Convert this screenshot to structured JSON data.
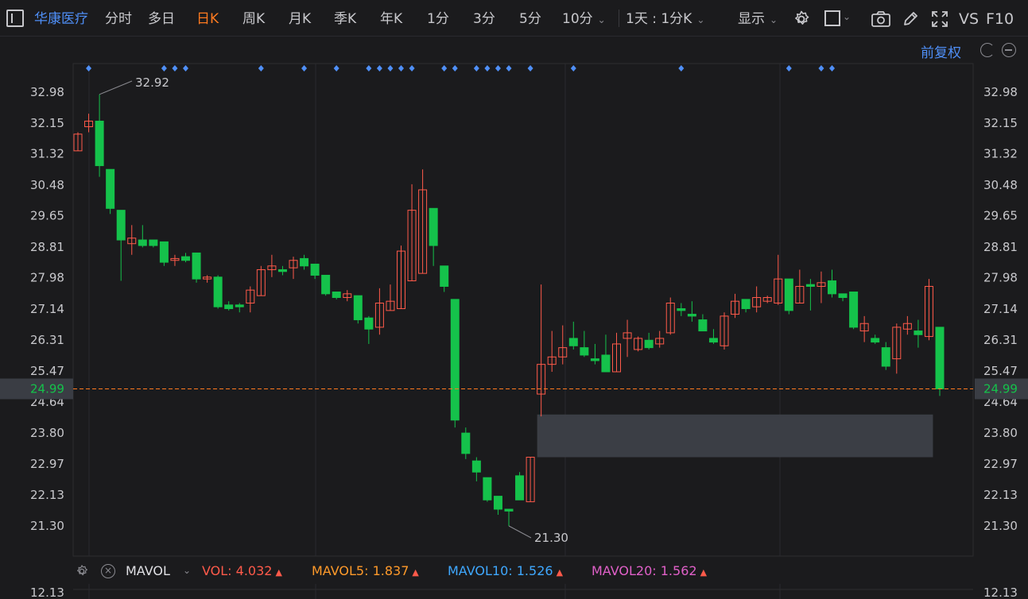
{
  "toolbar": {
    "stock_name": "华康医疗",
    "tabs": [
      {
        "label": "分时",
        "active": false
      },
      {
        "label": "多日",
        "active": false
      },
      {
        "label": "日K",
        "active": true
      },
      {
        "label": "周K",
        "active": false
      },
      {
        "label": "月K",
        "active": false
      },
      {
        "label": "季K",
        "active": false
      },
      {
        "label": "年K",
        "active": false
      },
      {
        "label": "1分",
        "active": false
      },
      {
        "label": "3分",
        "active": false
      },
      {
        "label": "5分",
        "active": false
      },
      {
        "label": "10分",
        "active": false
      }
    ],
    "period_select": "1天 : 1分K",
    "display_label": "显示",
    "vs_label": "VS",
    "f10_label": "F10"
  },
  "chart_header": {
    "adjust_label": "前复权"
  },
  "colors": {
    "up": "#ff5a4a",
    "down": "#15c24b",
    "accent": "#ff7a1f",
    "link": "#4f8ff7",
    "marker": "#4f8ff7",
    "price_line": "#ff7a1f",
    "price_tag_bg": "#3a3d44",
    "price_tag_text": "#15c24b"
  },
  "volume_legend": {
    "name": "MAVOL",
    "vol_label": "VOL:",
    "vol_value": "4.032",
    "mavol5_label": "MAVOL5:",
    "mavol5_value": "1.837",
    "mavol10_label": "MAVOL10:",
    "mavol10_value": "1.526",
    "mavol20_label": "MAVOL20:",
    "mavol20_value": "1.562",
    "axis_top": "12.13"
  },
  "chart_data": {
    "type": "candlestick",
    "yticks": [
      "32.98",
      "32.15",
      "31.32",
      "30.48",
      "29.65",
      "28.81",
      "27.98",
      "27.14",
      "26.31",
      "25.47",
      "24.64",
      "23.80",
      "22.97",
      "22.13",
      "21.30"
    ],
    "ylim": [
      20.45,
      33.72
    ],
    "current_price": "24.99",
    "high_annotation": "32.92",
    "low_annotation": "21.30",
    "marker_indices": [
      1,
      8,
      9,
      10,
      17,
      21,
      24,
      27,
      28,
      29,
      30,
      31,
      34,
      35,
      37,
      38,
      39,
      40,
      42,
      46,
      56,
      66,
      69,
      70
    ],
    "zone": {
      "start_index": 43,
      "end_index": 79,
      "low": 23.15,
      "high": 24.3
    },
    "candles": [
      {
        "o": 31.4,
        "h": 31.9,
        "l": 31.4,
        "c": 31.85
      },
      {
        "o": 32.05,
        "h": 32.4,
        "l": 31.9,
        "c": 32.2
      },
      {
        "o": 32.2,
        "h": 32.92,
        "l": 30.7,
        "c": 31.0
      },
      {
        "o": 30.9,
        "h": 30.9,
        "l": 29.7,
        "c": 29.85
      },
      {
        "o": 29.8,
        "h": 29.8,
        "l": 27.9,
        "c": 29.0
      },
      {
        "o": 28.9,
        "h": 29.4,
        "l": 28.6,
        "c": 29.05
      },
      {
        "o": 29.0,
        "h": 29.4,
        "l": 28.8,
        "c": 28.85
      },
      {
        "o": 29.0,
        "h": 29.0,
        "l": 28.8,
        "c": 28.85
      },
      {
        "o": 28.95,
        "h": 28.95,
        "l": 28.3,
        "c": 28.4
      },
      {
        "o": 28.45,
        "h": 28.6,
        "l": 28.3,
        "c": 28.5
      },
      {
        "o": 28.55,
        "h": 28.65,
        "l": 28.4,
        "c": 28.45
      },
      {
        "o": 28.65,
        "h": 28.65,
        "l": 27.85,
        "c": 27.95
      },
      {
        "o": 27.95,
        "h": 28.05,
        "l": 27.85,
        "c": 28.0
      },
      {
        "o": 28.0,
        "h": 28.05,
        "l": 27.15,
        "c": 27.2
      },
      {
        "o": 27.25,
        "h": 27.35,
        "l": 27.1,
        "c": 27.15
      },
      {
        "o": 27.25,
        "h": 27.3,
        "l": 27.05,
        "c": 27.2
      },
      {
        "o": 27.3,
        "h": 27.75,
        "l": 27.05,
        "c": 27.65
      },
      {
        "o": 27.5,
        "h": 28.3,
        "l": 27.5,
        "c": 28.2
      },
      {
        "o": 28.2,
        "h": 28.6,
        "l": 28.0,
        "c": 28.3
      },
      {
        "o": 28.2,
        "h": 28.3,
        "l": 28.05,
        "c": 28.15
      },
      {
        "o": 28.25,
        "h": 28.55,
        "l": 27.95,
        "c": 28.45
      },
      {
        "o": 28.5,
        "h": 28.6,
        "l": 28.2,
        "c": 28.3
      },
      {
        "o": 28.35,
        "h": 28.35,
        "l": 27.95,
        "c": 28.05
      },
      {
        "o": 28.05,
        "h": 28.05,
        "l": 27.5,
        "c": 27.55
      },
      {
        "o": 27.6,
        "h": 27.6,
        "l": 27.4,
        "c": 27.45
      },
      {
        "o": 27.45,
        "h": 27.65,
        "l": 27.35,
        "c": 27.55
      },
      {
        "o": 27.5,
        "h": 27.5,
        "l": 26.75,
        "c": 26.85
      },
      {
        "o": 26.9,
        "h": 26.95,
        "l": 26.2,
        "c": 26.6
      },
      {
        "o": 26.65,
        "h": 27.7,
        "l": 26.45,
        "c": 27.3
      },
      {
        "o": 27.1,
        "h": 27.8,
        "l": 27.1,
        "c": 27.35
      },
      {
        "o": 27.15,
        "h": 28.85,
        "l": 27.15,
        "c": 28.7
      },
      {
        "o": 27.9,
        "h": 30.5,
        "l": 27.9,
        "c": 29.8
      },
      {
        "o": 28.1,
        "h": 30.9,
        "l": 28.1,
        "c": 30.35
      },
      {
        "o": 29.85,
        "h": 29.85,
        "l": 28.3,
        "c": 28.85
      },
      {
        "o": 28.3,
        "h": 28.3,
        "l": 27.6,
        "c": 27.75
      },
      {
        "o": 27.4,
        "h": 27.4,
        "l": 23.95,
        "c": 24.15
      },
      {
        "o": 23.8,
        "h": 23.95,
        "l": 23.1,
        "c": 23.25
      },
      {
        "o": 23.05,
        "h": 23.15,
        "l": 22.5,
        "c": 22.75
      },
      {
        "o": 22.6,
        "h": 22.6,
        "l": 21.95,
        "c": 22.0
      },
      {
        "o": 22.1,
        "h": 22.1,
        "l": 21.6,
        "c": 21.75
      },
      {
        "o": 21.75,
        "h": 21.75,
        "l": 21.3,
        "c": 21.7
      },
      {
        "o": 22.65,
        "h": 22.75,
        "l": 22.0,
        "c": 22.0
      },
      {
        "o": 21.95,
        "h": 23.15,
        "l": 21.95,
        "c": 23.15
      },
      {
        "o": 24.85,
        "h": 27.8,
        "l": 24.25,
        "c": 25.65
      },
      {
        "o": 25.65,
        "h": 26.55,
        "l": 25.45,
        "c": 25.85
      },
      {
        "o": 25.85,
        "h": 26.7,
        "l": 25.65,
        "c": 26.1
      },
      {
        "o": 26.35,
        "h": 26.8,
        "l": 26.05,
        "c": 26.15
      },
      {
        "o": 26.1,
        "h": 26.55,
        "l": 25.85,
        "c": 25.9
      },
      {
        "o": 25.8,
        "h": 26.2,
        "l": 25.65,
        "c": 25.75
      },
      {
        "o": 25.9,
        "h": 26.45,
        "l": 25.55,
        "c": 25.45
      },
      {
        "o": 25.45,
        "h": 26.5,
        "l": 25.45,
        "c": 26.2
      },
      {
        "o": 26.35,
        "h": 26.85,
        "l": 25.85,
        "c": 26.5
      },
      {
        "o": 26.05,
        "h": 26.4,
        "l": 26.0,
        "c": 26.35
      },
      {
        "o": 26.3,
        "h": 26.5,
        "l": 26.05,
        "c": 26.1
      },
      {
        "o": 26.2,
        "h": 26.55,
        "l": 26.1,
        "c": 26.35
      },
      {
        "o": 26.5,
        "h": 27.45,
        "l": 26.45,
        "c": 27.3
      },
      {
        "o": 27.15,
        "h": 27.3,
        "l": 26.95,
        "c": 27.1
      },
      {
        "o": 27.0,
        "h": 27.35,
        "l": 26.8,
        "c": 26.95
      },
      {
        "o": 26.85,
        "h": 27.0,
        "l": 26.6,
        "c": 26.55
      },
      {
        "o": 26.35,
        "h": 26.6,
        "l": 26.2,
        "c": 26.25
      },
      {
        "o": 26.15,
        "h": 27.05,
        "l": 26.05,
        "c": 26.95
      },
      {
        "o": 27.0,
        "h": 27.55,
        "l": 26.9,
        "c": 27.35
      },
      {
        "o": 27.4,
        "h": 27.4,
        "l": 27.05,
        "c": 27.15
      },
      {
        "o": 27.2,
        "h": 27.75,
        "l": 27.05,
        "c": 27.45
      },
      {
        "o": 27.35,
        "h": 27.5,
        "l": 27.3,
        "c": 27.45
      },
      {
        "o": 27.3,
        "h": 28.6,
        "l": 27.25,
        "c": 27.95
      },
      {
        "o": 27.95,
        "h": 27.95,
        "l": 27.0,
        "c": 27.1
      },
      {
        "o": 27.3,
        "h": 28.2,
        "l": 27.3,
        "c": 27.75
      },
      {
        "o": 27.8,
        "h": 27.95,
        "l": 27.1,
        "c": 27.75
      },
      {
        "o": 27.75,
        "h": 28.15,
        "l": 27.3,
        "c": 27.85
      },
      {
        "o": 27.9,
        "h": 28.2,
        "l": 27.45,
        "c": 27.55
      },
      {
        "o": 27.55,
        "h": 27.55,
        "l": 27.35,
        "c": 27.45
      },
      {
        "o": 27.6,
        "h": 27.6,
        "l": 26.6,
        "c": 26.65
      },
      {
        "o": 26.55,
        "h": 26.95,
        "l": 26.25,
        "c": 26.75
      },
      {
        "o": 26.35,
        "h": 26.45,
        "l": 26.2,
        "c": 26.25
      },
      {
        "o": 26.1,
        "h": 26.25,
        "l": 25.5,
        "c": 25.6
      },
      {
        "o": 25.8,
        "h": 26.75,
        "l": 25.4,
        "c": 26.65
      },
      {
        "o": 26.6,
        "h": 26.95,
        "l": 26.45,
        "c": 26.75
      },
      {
        "o": 26.55,
        "h": 26.85,
        "l": 26.1,
        "c": 26.45
      },
      {
        "o": 26.4,
        "h": 27.95,
        "l": 26.3,
        "c": 27.75
      },
      {
        "o": 26.65,
        "h": 26.65,
        "l": 24.8,
        "c": 24.99
      }
    ]
  }
}
